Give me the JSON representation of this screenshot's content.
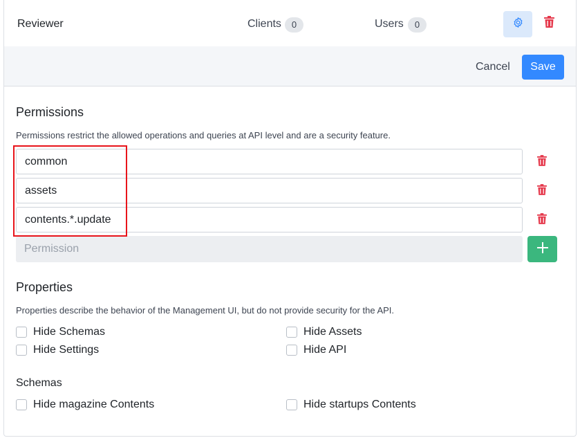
{
  "role": {
    "name": "Reviewer",
    "clients_label": "Clients",
    "clients_count": "0",
    "users_label": "Users",
    "users_count": "0"
  },
  "actions": {
    "cancel_label": "Cancel",
    "save_label": "Save"
  },
  "permissions": {
    "title": "Permissions",
    "description": "Permissions restrict the allowed operations and queries at API level and are a security feature.",
    "items": [
      "common",
      "assets",
      "contents.*.update"
    ],
    "new_placeholder": "Permission"
  },
  "properties": {
    "title": "Properties",
    "description": "Properties describe the behavior of the Management UI, but do not provide security for the API.",
    "options": [
      {
        "label": "Hide Schemas",
        "checked": false
      },
      {
        "label": "Hide Assets",
        "checked": false
      },
      {
        "label": "Hide Settings",
        "checked": false
      },
      {
        "label": "Hide API",
        "checked": false
      }
    ]
  },
  "schemas": {
    "title": "Schemas",
    "options": [
      {
        "label": "Hide magazine Contents",
        "checked": false
      },
      {
        "label": "Hide startups Contents",
        "checked": false
      }
    ]
  },
  "colors": {
    "primary": "#3389ff",
    "success": "#3bb77e",
    "danger": "#e5384b",
    "highlight": "#e8131a"
  }
}
